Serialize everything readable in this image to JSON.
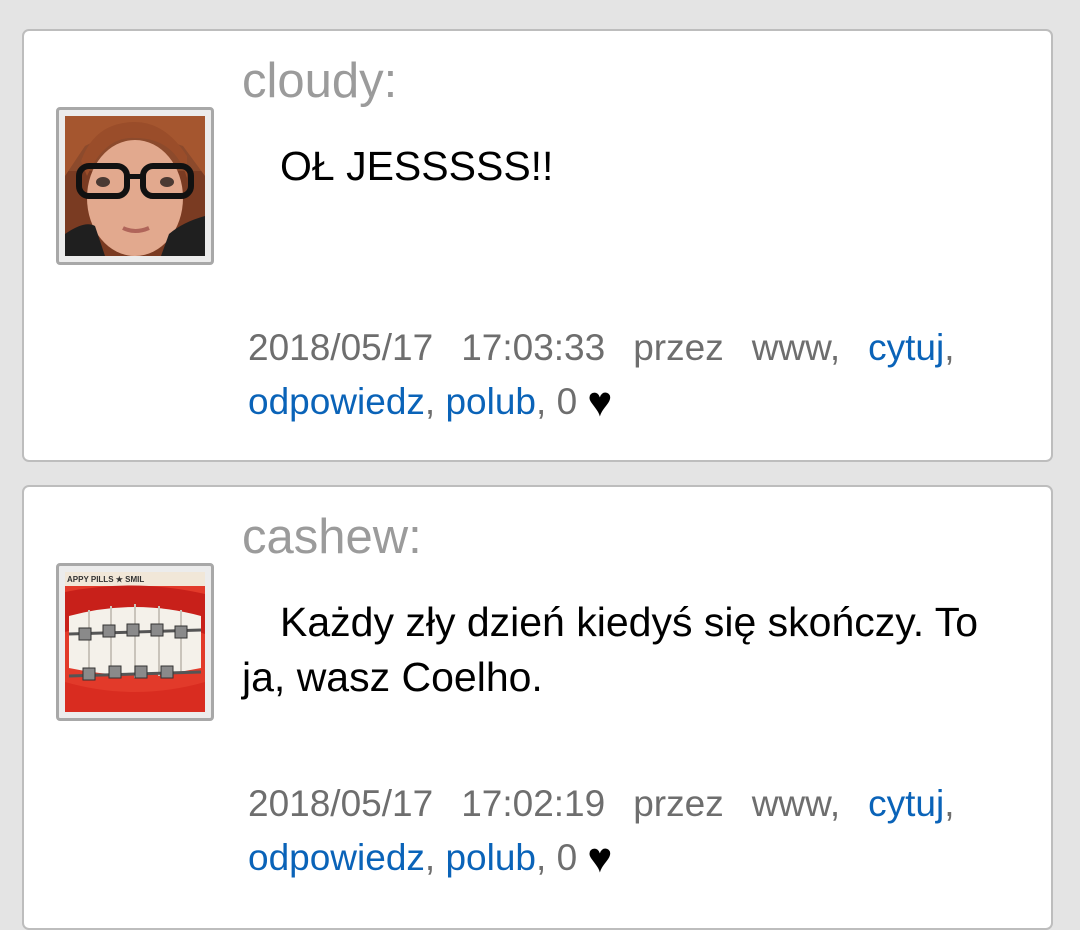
{
  "posts": [
    {
      "username": "cloudy:",
      "message": "OŁ JESSSSS!!",
      "date": "2018/05/17",
      "time": "17:03:33",
      "via": "przez",
      "source": "www,",
      "quote_label": "cytuj",
      "reply_label": "odpowiedz",
      "like_label": "polub",
      "likes": "0",
      "heart": "♥"
    },
    {
      "username": "cashew:",
      "message": "Każdy zły dzień kiedyś się skończy. To ja, wasz Coelho.",
      "date": "2018/05/17",
      "time": "17:02:19",
      "via": "przez",
      "source": "www,",
      "quote_label": "cytuj",
      "reply_label": "odpowiedz",
      "like_label": "polub",
      "likes": "0",
      "heart": "♥",
      "avatar_caption": "APPY PILLS ★ SMIL"
    }
  ],
  "colors": {
    "background": "#e4e4e4",
    "card": "#ffffff",
    "username": "#9b9b9b",
    "meta": "#6e6e6e",
    "link": "#0a63b8"
  }
}
